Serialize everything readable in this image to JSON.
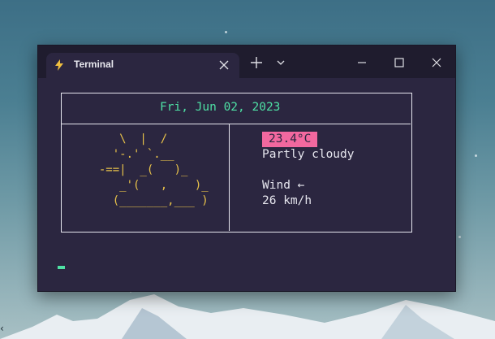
{
  "window": {
    "tab_title": "Terminal",
    "icons": {
      "tab": "lightning-icon",
      "close_tab": "close-icon",
      "new_tab": "plus-icon",
      "dropdown": "chevron-down-icon",
      "minimize": "minimize-icon",
      "maximize": "maximize-icon",
      "close_window": "close-icon"
    }
  },
  "terminal": {
    "date": "Fri, Jun 02, 2023",
    "art_lines": [
      "     \\  |  /",
      "    '-.' `.__",
      "  -==|  _(   )_",
      "     _'(   ,    )_",
      "    (_______,___ )"
    ],
    "temperature": "23.4°C",
    "condition": "Partly cloudy",
    "wind_label": "Wind ←",
    "wind_speed": "26 km/h"
  },
  "colors": {
    "date": "#4ee0a4",
    "art": "#e8c24a",
    "temp_bg": "#f2689f",
    "terminal_bg": "#2b2640",
    "titlebar_bg": "#1f1c2e"
  },
  "desktop": {
    "edge_glyph": "‹"
  }
}
